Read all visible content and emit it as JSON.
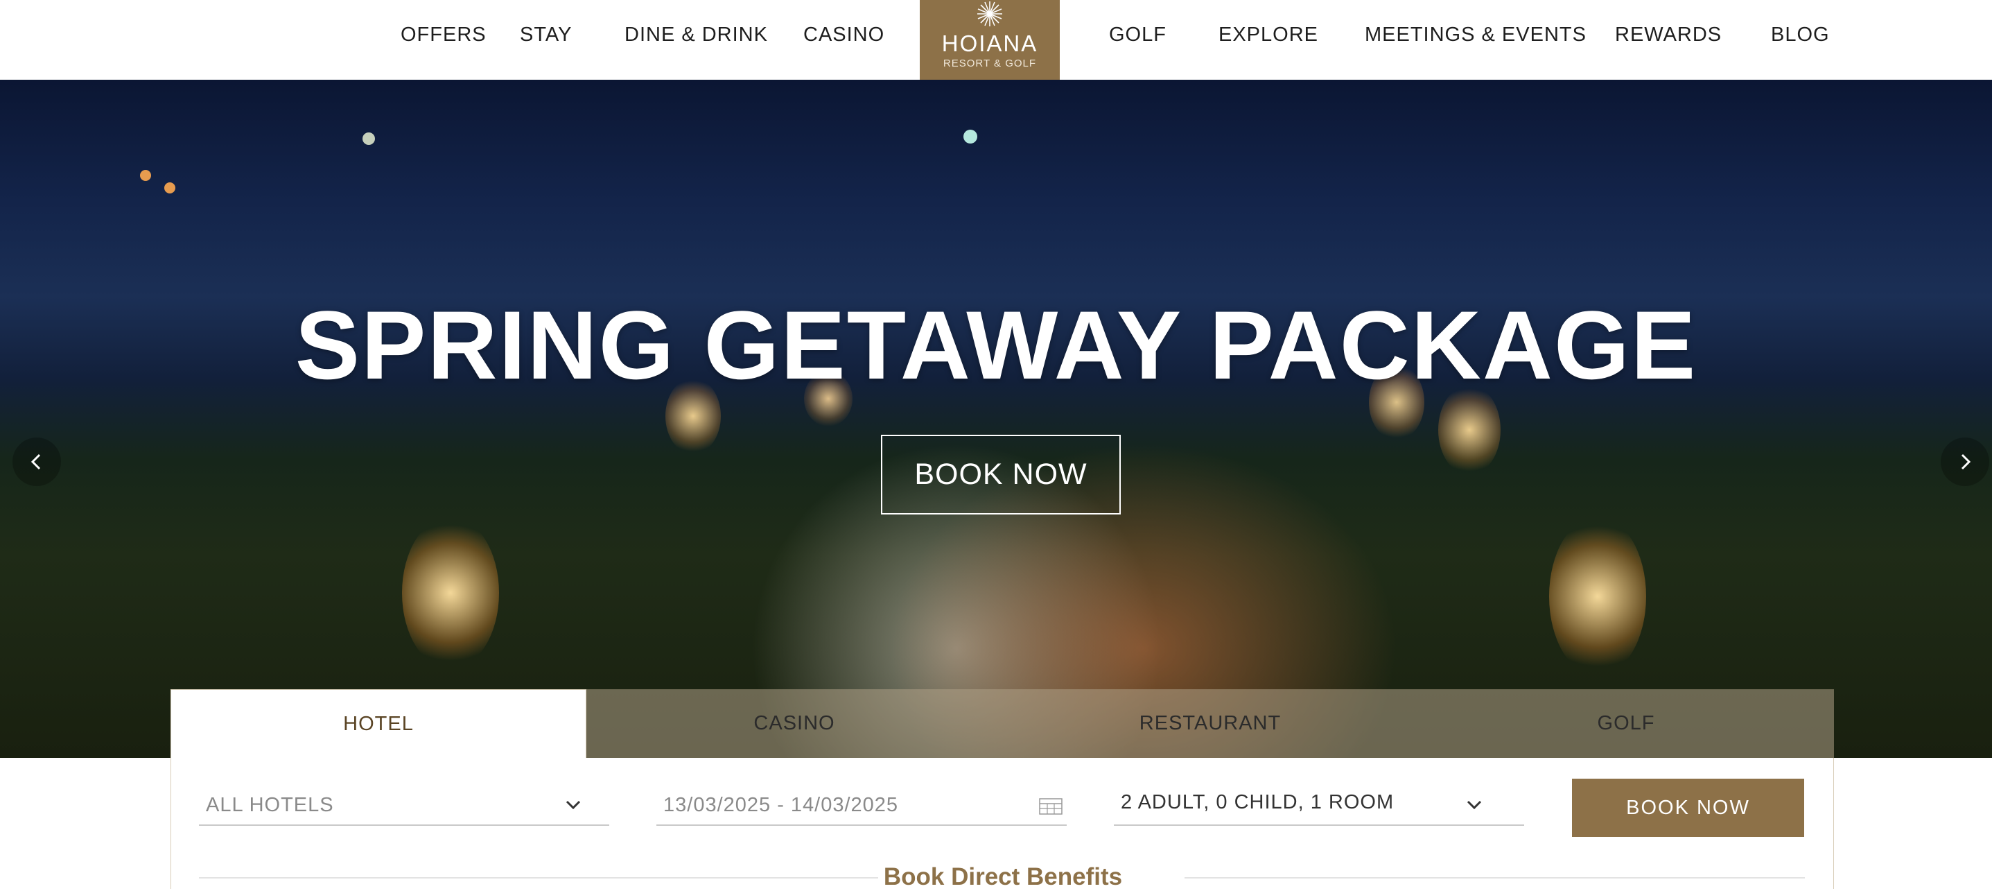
{
  "nav": {
    "items": [
      "OFFERS",
      "STAY",
      "DINE & DRINK",
      "CASINO",
      "GOLF",
      "EXPLORE",
      "MEETINGS & EVENTS",
      "REWARDS",
      "BLOG"
    ],
    "logo": {
      "name": "HOIANA",
      "sub": "RESORT & GOLF"
    }
  },
  "hero": {
    "title": "SPRING GETAWAY PACKAGE",
    "cta": "BOOK NOW",
    "prev_icon": "chevron-left-icon",
    "next_icon": "chevron-right-icon"
  },
  "booking": {
    "tabs": [
      "HOTEL",
      "CASINO",
      "RESTAURANT",
      "GOLF"
    ],
    "active_tab": "HOTEL",
    "hotel_select": "ALL HOTELS",
    "dates": "13/03/2025 - 14/03/2025",
    "guests": "2 ADULT, 0 CHILD, 1 ROOM",
    "submit": "BOOK NOW",
    "benefits_heading": "Book Direct Benefits"
  },
  "colors": {
    "brand": "#8d7148",
    "text": "#1e1e1e"
  }
}
